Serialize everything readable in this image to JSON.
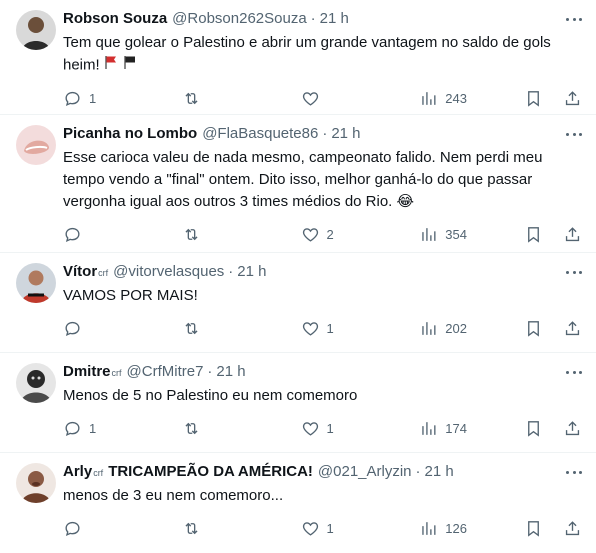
{
  "tweets": [
    {
      "name": "Robson Souza",
      "badge": "",
      "name_extra": "",
      "handle": "@Robson262Souza",
      "time": "21 h",
      "text": "Tem que golear o Palestino e abrir um grande vantagem no saldo de gols heim!",
      "emoji": "flags-red-black",
      "replies": "1",
      "retweets": "",
      "likes": "",
      "views": "243",
      "avatar_color": "#2b2b2b"
    },
    {
      "name": "Picanha no Lombo",
      "badge": "",
      "name_extra": "",
      "handle": "@FlaBasquete86",
      "time": "21 h",
      "text": "Esse carioca valeu de nada mesmo, campeonato falido. Nem perdi meu tempo vendo a \"final\" ontem. Dito isso, melhor ganhá-lo do que passar vergonha igual aos outros 3 times médios do Rio. 😂",
      "emoji": "",
      "replies": "",
      "retweets": "",
      "likes": "2",
      "views": "354",
      "avatar_color": "#e8c9c9"
    },
    {
      "name": "Vítor",
      "badge": "crf",
      "name_extra": "",
      "handle": "@vitorvelasques",
      "time": "21 h",
      "text": "VAMOS POR MAIS!",
      "emoji": "",
      "replies": "",
      "retweets": "",
      "likes": "1",
      "views": "202",
      "avatar_color": "#c0392b"
    },
    {
      "name": "Dmitre",
      "badge": "crf",
      "name_extra": "",
      "handle": "@CrfMitre7",
      "time": "21 h",
      "text": "Menos de 5 no Palestino eu nem comemoro",
      "emoji": "",
      "replies": "1",
      "retweets": "",
      "likes": "1",
      "views": "174",
      "avatar_color": "#3a3a3a"
    },
    {
      "name": "Arly",
      "badge": "crf",
      "name_extra": "TRICAMPEÃO DA AMÉRICA!",
      "handle": "@021_Arlyzin",
      "time": "21 h",
      "text": "menos de 3 eu nem comemoro...",
      "emoji": "",
      "replies": "",
      "retweets": "",
      "likes": "1",
      "views": "126",
      "avatar_color": "#8a5a44"
    }
  ],
  "separator": "·",
  "icons": {
    "reply": "reply-icon",
    "retweet": "retweet-icon",
    "like": "heart-icon",
    "views": "views-icon",
    "bookmark": "bookmark-icon",
    "share": "share-icon",
    "more": "more-icon"
  }
}
